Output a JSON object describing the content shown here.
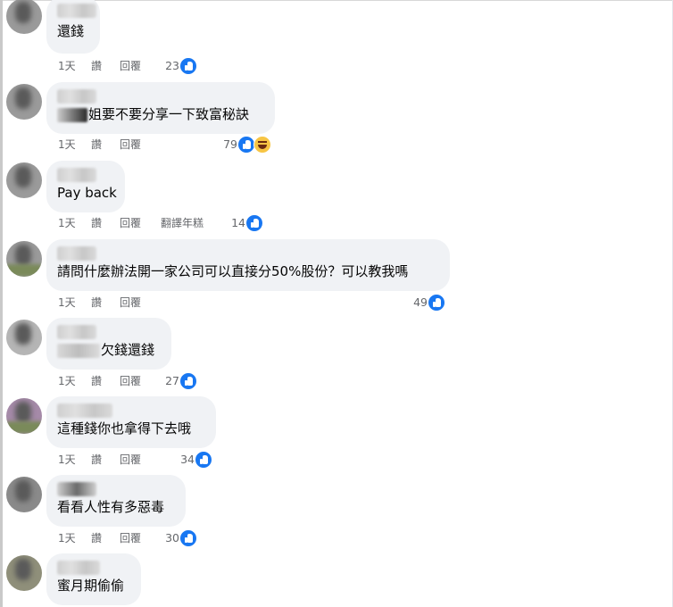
{
  "actions": {
    "time": "1天",
    "like": "讚",
    "reply": "回覆",
    "translate": "翻譯年糕"
  },
  "comments": [
    {
      "text": "還錢",
      "likes": "23"
    },
    {
      "text": "姐要不要分享一下致富秘訣",
      "likes": "79"
    },
    {
      "text": "Pay back",
      "likes": "14"
    },
    {
      "text": "請問什麼辦法開一家公司可以直接分50%股份？可以教我嗎",
      "likes": "49"
    },
    {
      "text": "欠錢還錢",
      "likes": "27"
    },
    {
      "text": "這種錢你也拿得下去哦",
      "likes": "34"
    },
    {
      "text": "看看人性有多惡毒",
      "likes": "30"
    },
    {
      "text": "蜜月期偷偷"
    }
  ],
  "icons": {
    "like": "like-icon",
    "haha": "haha-icon"
  },
  "colors": {
    "bubble": "#f0f2f5",
    "like_blue": "#1877f2",
    "meta_text": "#65676b"
  }
}
